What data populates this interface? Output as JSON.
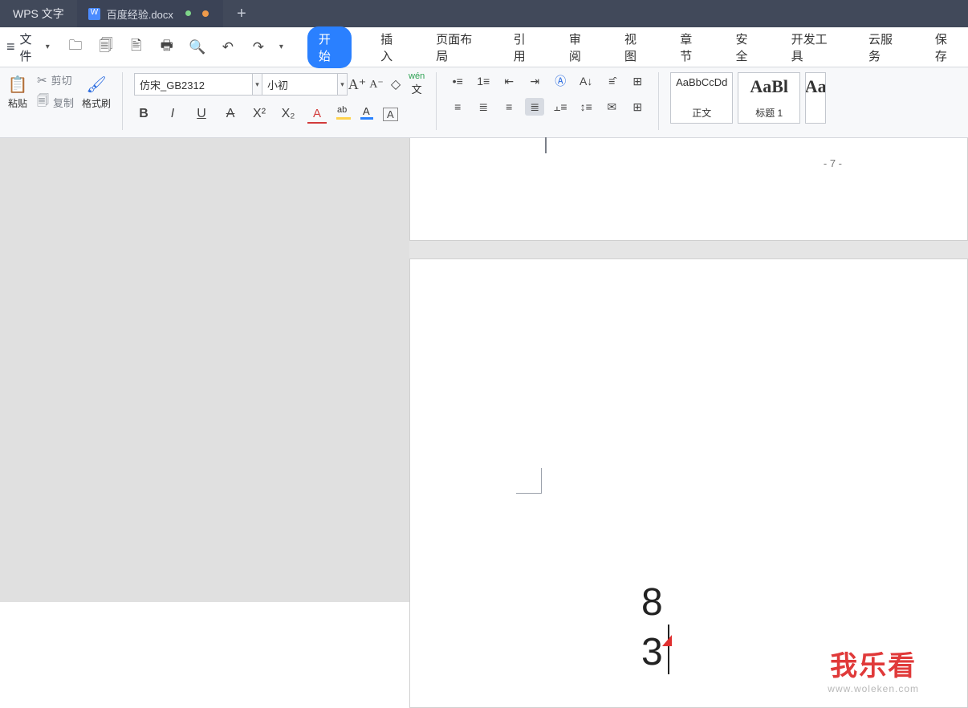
{
  "titlebar": {
    "app": "WPS 文字",
    "tab_filename": "百度经验.docx",
    "addtab": "+"
  },
  "file_menu": {
    "label": "文件"
  },
  "ribbon_tabs": [
    "开始",
    "插入",
    "页面布局",
    "引用",
    "审阅",
    "视图",
    "章节",
    "安全",
    "开发工具",
    "云服务",
    "保存"
  ],
  "ribbon_active_index": 0,
  "clipboard": {
    "paste": "粘贴",
    "cut": "剪切",
    "copy": "复制",
    "format_painter": "格式刷"
  },
  "font": {
    "name": "仿宋_GB2312",
    "size": "小初"
  },
  "styles": [
    {
      "preview": "AaBbCcDd",
      "label": "正文",
      "big": false
    },
    {
      "preview": "AaBl",
      "label": "标题 1",
      "big": true
    },
    {
      "preview": "Aa",
      "label": "",
      "big": true
    }
  ],
  "document": {
    "prev_page_number": "- 7 -",
    "body_text": "8 3"
  },
  "watermark": {
    "brand": "我乐看",
    "url": "www.woleken.com"
  }
}
